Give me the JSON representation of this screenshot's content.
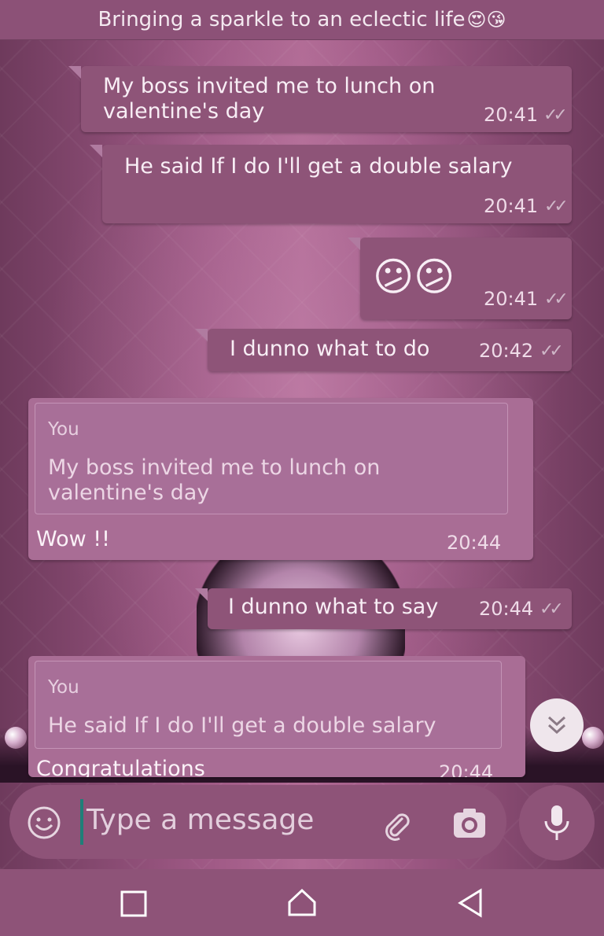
{
  "status_line": {
    "text": "Bringing a sparkle to an eclectic life",
    "emojis": "😍😘"
  },
  "messages": [
    {
      "text": "My boss invited me to lunch on valentine's day",
      "time": "20:41",
      "ticks": "✓✓"
    },
    {
      "text": "He said If I do I'll get a double salary",
      "time": "20:41",
      "ticks": "✓✓"
    },
    {
      "text": "😕😕",
      "time": "20:41",
      "ticks": "✓✓"
    },
    {
      "text": "I dunno what to do",
      "time": "20:42",
      "ticks": "✓✓"
    },
    {
      "quote_author": "You",
      "quote_text": "My boss invited me to lunch on valentine's day",
      "text": "Wow !!",
      "time": "20:44"
    },
    {
      "text": "I dunno what to say",
      "time": "20:44",
      "ticks": "✓✓"
    },
    {
      "quote_author": "You",
      "quote_text": "He said If I do I'll get a double salary",
      "text": "Congratulations",
      "time": "20:44"
    }
  ],
  "composer": {
    "placeholder": "Type a message"
  },
  "icons": {
    "emoji": "emoji-icon",
    "attach": "paperclip-icon",
    "camera": "camera-icon",
    "mic": "mic-icon",
    "scroll_down": "chevron-double-down-icon",
    "nav_back": "triangle-back-icon",
    "nav_home": "home-icon",
    "nav_recents": "square-recents-icon"
  },
  "colors": {
    "bar": "#8c5177",
    "bubble": "#8e5478",
    "quote_bubble": "#a96d95",
    "cursor": "#1f7f78"
  }
}
